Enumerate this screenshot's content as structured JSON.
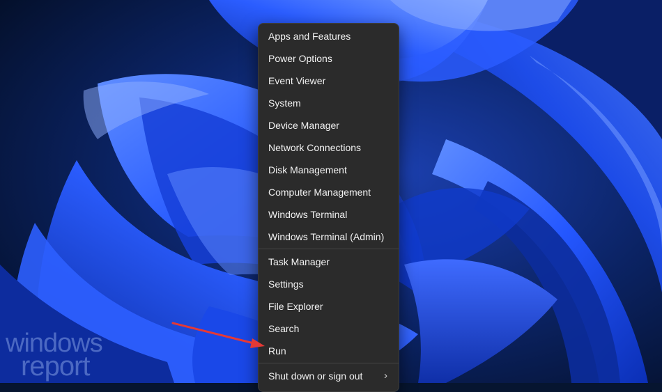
{
  "context_menu": {
    "items": [
      {
        "label": "Apps and Features"
      },
      {
        "label": "Power Options"
      },
      {
        "label": "Event Viewer"
      },
      {
        "label": "System"
      },
      {
        "label": "Device Manager"
      },
      {
        "label": "Network Connections"
      },
      {
        "label": "Disk Management"
      },
      {
        "label": "Computer Management"
      },
      {
        "label": "Windows Terminal"
      },
      {
        "label": "Windows Terminal (Admin)"
      }
    ],
    "items_group2": [
      {
        "label": "Task Manager"
      },
      {
        "label": "Settings"
      },
      {
        "label": "File Explorer"
      },
      {
        "label": "Search"
      },
      {
        "label": "Run"
      }
    ],
    "items_group3": [
      {
        "label": "Shut down or sign out",
        "submenu_icon": "chevron-right-icon"
      }
    ]
  },
  "watermark": {
    "line1": "windows",
    "line2": "report"
  },
  "annotation": {
    "arrow_color": "#e53935",
    "points_to": "Run"
  },
  "colors": {
    "menu_background": "#2b2b2b",
    "menu_text": "#f2f2f2",
    "wallpaper_accent": "#1f4fff"
  }
}
